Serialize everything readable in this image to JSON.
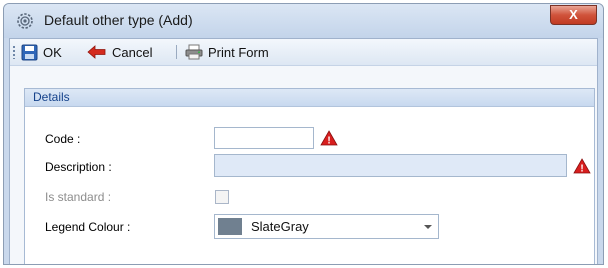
{
  "window": {
    "title": "Default other type (Add)",
    "close_label": "X",
    "icon": "gear-icon"
  },
  "toolbar": {
    "ok_label": "OK",
    "cancel_label": "Cancel",
    "print_label": "Print Form",
    "icons": {
      "ok": "save-icon",
      "cancel": "back-arrow-icon",
      "print": "print-icon"
    }
  },
  "details": {
    "header": "Details",
    "code_label": "Code :",
    "code_value": "",
    "description_label": "Description :",
    "description_value": "",
    "is_standard_label": "Is standard :",
    "is_standard_checked": false,
    "legend_label": "Legend Colour :",
    "legend_value": "SlateGray",
    "legend_color": "#708090",
    "validation_icon": "warning-icon"
  },
  "colors": {
    "accent": "#15428b",
    "warning": "#d81e1e",
    "close": "#c9442b"
  }
}
